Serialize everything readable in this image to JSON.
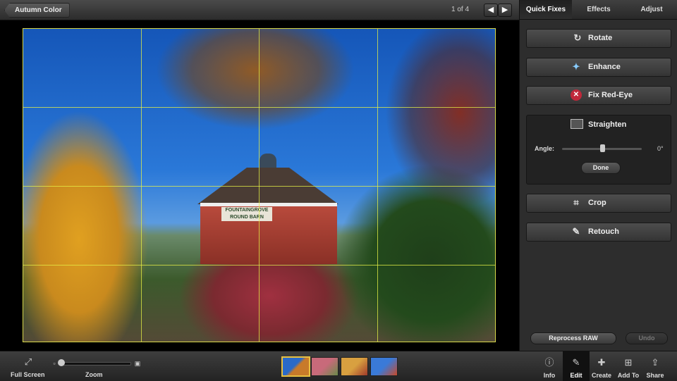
{
  "toolbar": {
    "album_label": "Autumn Color",
    "counter": "1 of 4",
    "prev_glyph": "◀",
    "next_glyph": "▶"
  },
  "panel": {
    "tabs": [
      {
        "label": "Quick Fixes",
        "active": true
      },
      {
        "label": "Effects",
        "active": false
      },
      {
        "label": "Adjust",
        "active": false
      }
    ],
    "fixes": [
      {
        "label": "Rotate",
        "icon": "rotate-icon",
        "glyph": "↻"
      },
      {
        "label": "Enhance",
        "icon": "wand-icon",
        "glyph": "✦"
      },
      {
        "label": "Fix Red-Eye",
        "icon": "red-eye-icon",
        "glyph": "✕"
      },
      {
        "label": "Crop",
        "icon": "crop-icon",
        "glyph": "⌗"
      },
      {
        "label": "Retouch",
        "icon": "brush-icon",
        "glyph": "✎"
      }
    ],
    "straighten": {
      "title": "Straighten",
      "angle_label": "Angle:",
      "angle_value": "0°",
      "angle_fraction": 0.5,
      "done_label": "Done"
    },
    "reprocess_label": "Reprocess RAW",
    "undo_label": "Undo"
  },
  "photo": {
    "sign_text": "FOUNTAINGROVE ROUND BARN",
    "grid_lines": "thirds"
  },
  "bottombar": {
    "fullscreen_label": "Full Screen",
    "zoom_label": "Zoom",
    "zoom_fraction": 0.0,
    "thumbnails": [
      {
        "name": "thumb-1",
        "selected": true,
        "colors": [
          "#2a6ac8",
          "#c87a2a"
        ]
      },
      {
        "name": "thumb-2",
        "selected": false,
        "colors": [
          "#c86a7a",
          "#6a8a4a"
        ]
      },
      {
        "name": "thumb-3",
        "selected": false,
        "colors": [
          "#d8a040",
          "#a03a2a"
        ]
      },
      {
        "name": "thumb-4",
        "selected": false,
        "colors": [
          "#3a7ad8",
          "#c84a2a"
        ]
      }
    ],
    "tools": [
      {
        "label": "Info",
        "icon": "info-icon",
        "glyph": "ⓘ"
      },
      {
        "label": "Edit",
        "icon": "edit-icon",
        "glyph": "✎",
        "active": true
      },
      {
        "label": "Create",
        "icon": "create-icon",
        "glyph": "✚"
      },
      {
        "label": "Add To",
        "icon": "add-to-icon",
        "glyph": "⊞"
      },
      {
        "label": "Share",
        "icon": "share-icon",
        "glyph": "⇪"
      }
    ]
  },
  "colors": {
    "grid": "#e6f046",
    "selection": "#e8c040",
    "panel_bg": "#2d2d2d"
  }
}
